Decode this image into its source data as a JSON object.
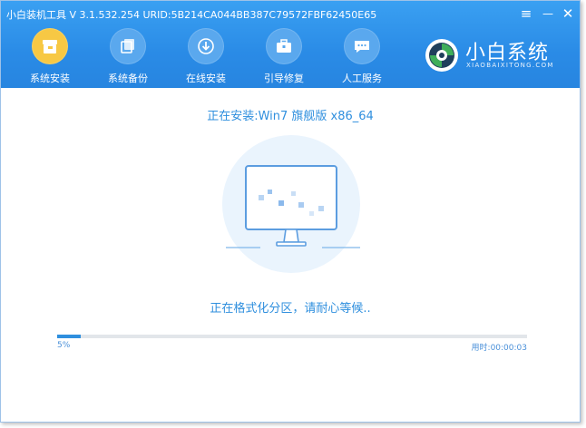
{
  "app": {
    "title": "小白装机工具 V 3.1.532.254 URID:5B214CA044BB387C79572FBF62450E65"
  },
  "window_controls": {
    "menu": "≡",
    "minimize": "—",
    "close": "✕"
  },
  "nav": {
    "items": [
      {
        "label": "系统安装",
        "icon": "box-icon",
        "active": true
      },
      {
        "label": "系统备份",
        "icon": "backup-icon",
        "active": false
      },
      {
        "label": "在线安装",
        "icon": "download-icon",
        "active": false
      },
      {
        "label": "引导修复",
        "icon": "toolbox-icon",
        "active": false
      },
      {
        "label": "人工服务",
        "icon": "chat-icon",
        "active": false
      }
    ]
  },
  "logo": {
    "name": "小白系统",
    "sub": "XIAOBAIXITONG.COM"
  },
  "install": {
    "title": "正在安装:Win7 旗舰版 x86_64",
    "status": "正在格式化分区，请耐心等候..",
    "progress_percent": 5,
    "progress_label": "5%",
    "elapsed": "用时:00:00:03"
  },
  "colors": {
    "header": "#2a8be6",
    "accent": "#2f8fde",
    "active_nav": "#f7c844"
  }
}
